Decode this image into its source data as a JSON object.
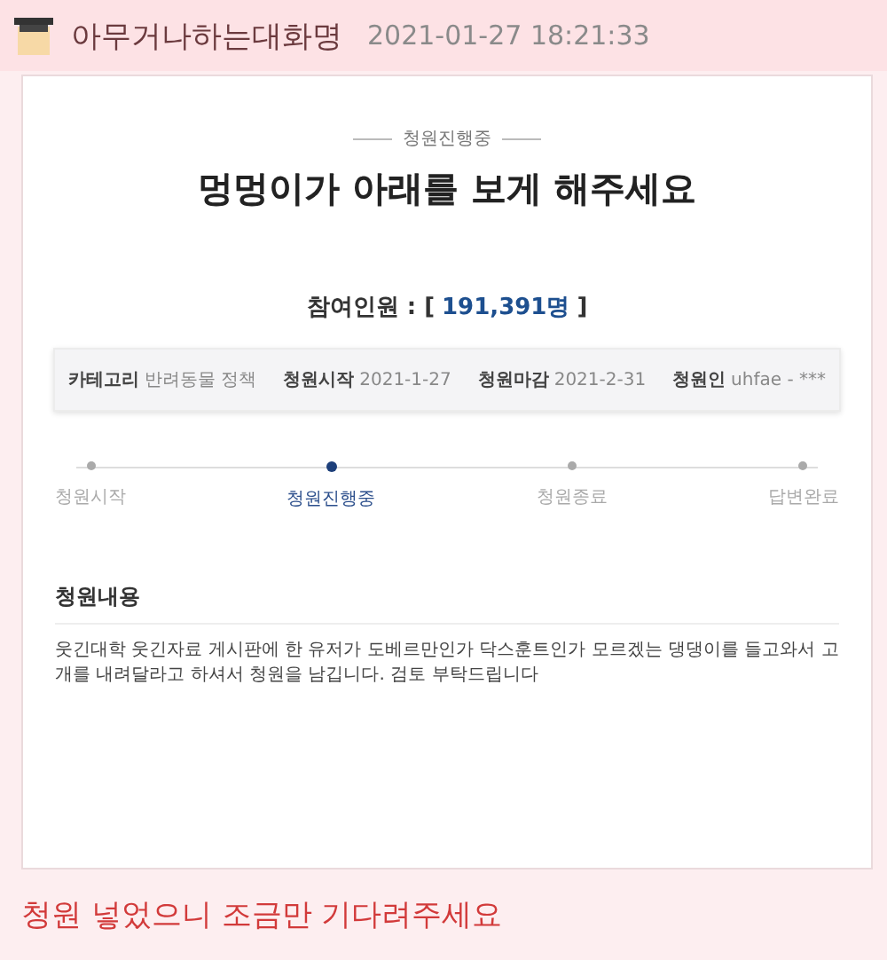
{
  "post": {
    "author": "아무거나하는대화명",
    "timestamp": "2021-01-27 18:21:33"
  },
  "petition": {
    "status": "청원진행중",
    "title": "멍멍이가 아래를 보게 해주세요",
    "count_label": "참여인원 : [",
    "count": "191,391명",
    "count_close": "]",
    "info": [
      {
        "label": "카테고리",
        "value": "반려동물 정책"
      },
      {
        "label": "청원시작",
        "value": "2021-1-27"
      },
      {
        "label": "청원마감",
        "value": "2021-2-31"
      },
      {
        "label": "청원인",
        "value": "uhfae - ***"
      }
    ],
    "steps": [
      {
        "label": "청원시작",
        "selected": false
      },
      {
        "label": "청원진행중",
        "selected": true
      },
      {
        "label": "청원종료",
        "selected": false
      },
      {
        "label": "답변완료",
        "selected": false
      }
    ],
    "section_title": "청원내용",
    "body": "웃긴대학 웃긴자료 게시판에 한 유저가 도베르만인가 닥스훈트인가 모르겠는 댕댕이를 들고와서 고개를 내려달라고 하셔서 청원을 남깁니다. 검토 부탁드립니다"
  },
  "comment": "청원 넣었으니 조금만 기다려주세요"
}
